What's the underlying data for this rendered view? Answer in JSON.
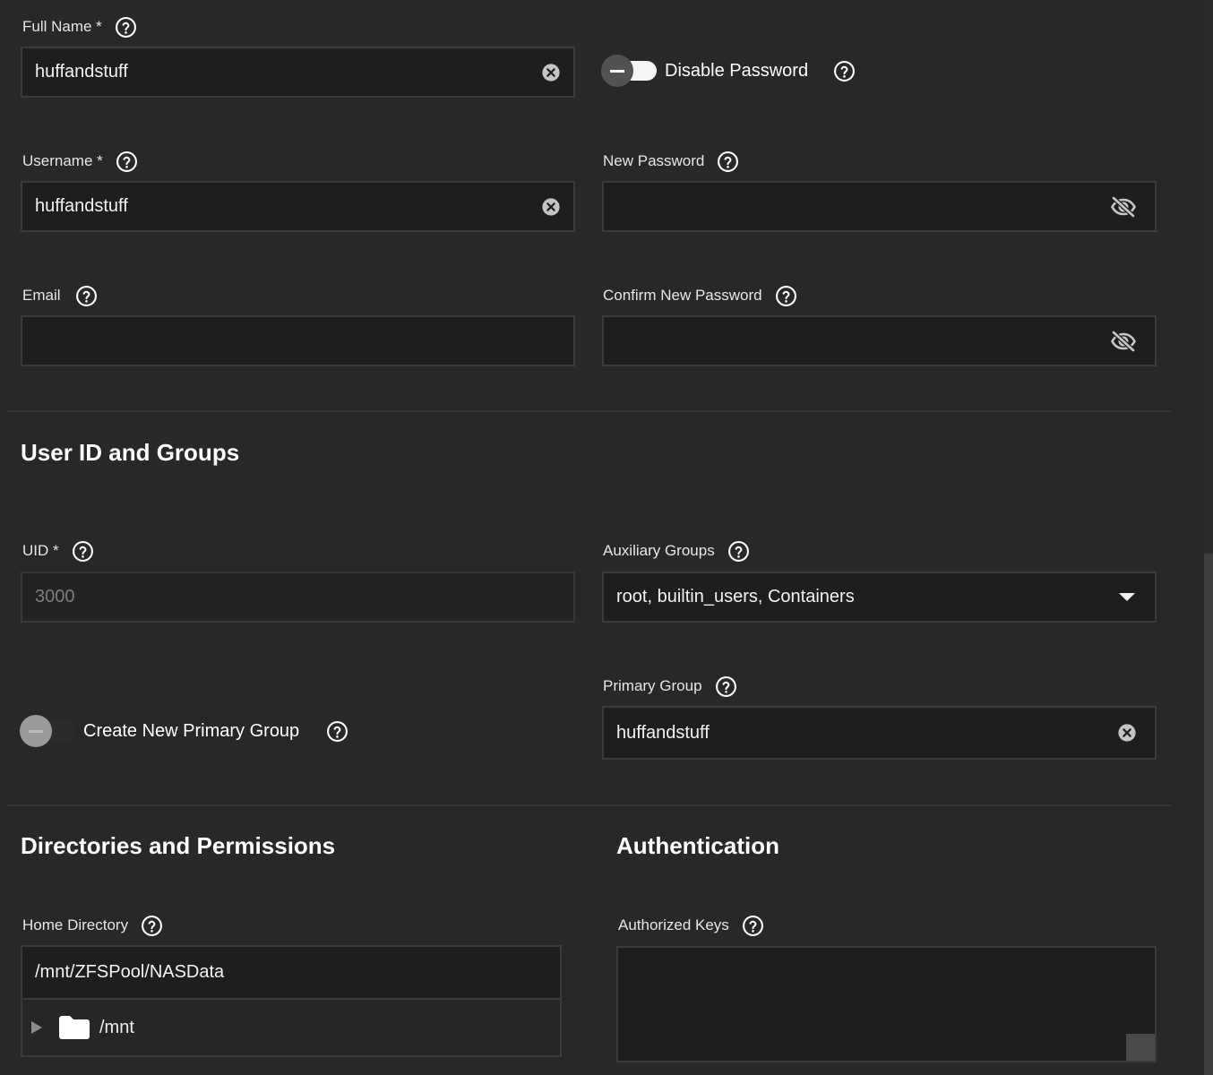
{
  "account": {
    "full_name": {
      "label": "Full Name *",
      "value": "huffandstuff"
    },
    "username": {
      "label": "Username *",
      "value": "huffandstuff"
    },
    "email": {
      "label": "Email",
      "value": ""
    },
    "disable_password": {
      "label": "Disable Password",
      "enabled": false
    },
    "new_password": {
      "label": "New Password",
      "value": ""
    },
    "confirm_password": {
      "label": "Confirm New Password",
      "value": ""
    }
  },
  "user_id_groups": {
    "title": "User ID and Groups",
    "uid": {
      "label": "UID *",
      "value": "3000"
    },
    "auxiliary_groups": {
      "label": "Auxiliary Groups",
      "value": "root, builtin_users, Containers"
    },
    "create_primary_group": {
      "label": "Create New Primary Group",
      "enabled": false
    },
    "primary_group": {
      "label": "Primary Group",
      "value": "huffandstuff"
    }
  },
  "directories": {
    "title": "Directories and Permissions",
    "home_directory": {
      "label": "Home Directory",
      "value": "/mnt/ZFSPool/NASData"
    },
    "tree": [
      {
        "label": "/mnt",
        "icon": "folder-icon",
        "expanded": false
      }
    ]
  },
  "authentication": {
    "title": "Authentication",
    "authorized_keys": {
      "label": "Authorized Keys",
      "value": ""
    }
  },
  "icons": {
    "help": "help-circle-icon",
    "clear": "clear-circle-icon",
    "visibility": "eye-off-icon",
    "dropdown": "caret-down-icon",
    "folder": "folder-icon"
  },
  "colors": {
    "background": "#282828",
    "field_background": "#1e1e1e",
    "field_border": "#3b3b3b",
    "text": "#ffffff",
    "disabled_text": "#7d7d7d"
  }
}
